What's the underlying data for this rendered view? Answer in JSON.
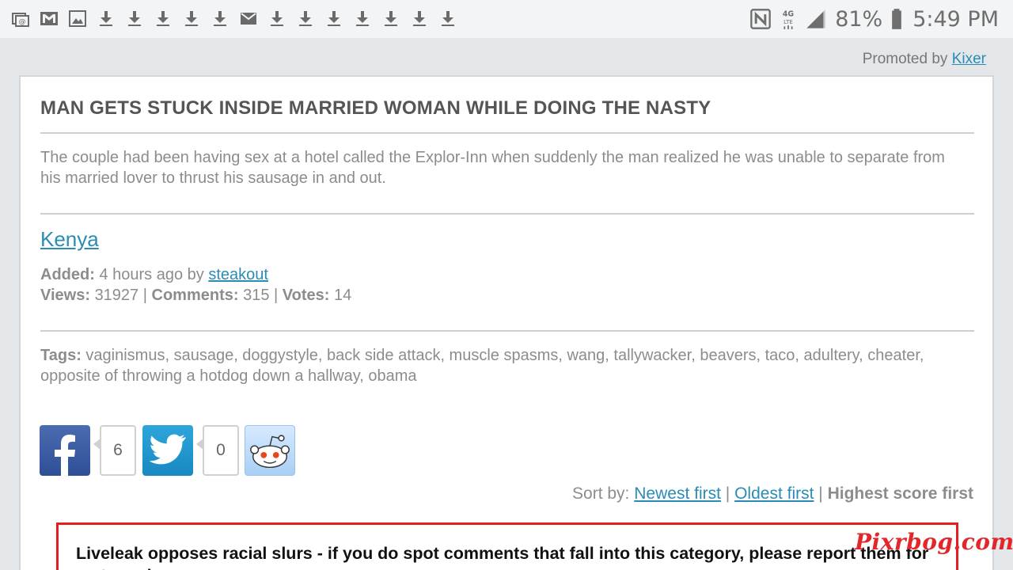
{
  "status_bar": {
    "left_icons": [
      "email-icon",
      "gmail-icon",
      "image-icon",
      "download-icon",
      "download-icon",
      "download-icon",
      "download-icon",
      "download-icon",
      "mail-icon",
      "download-icon",
      "download-icon",
      "download-icon",
      "download-icon",
      "download-icon",
      "download-icon",
      "download-icon",
      "download-icon"
    ],
    "battery": "81%",
    "time": "5:49 PM"
  },
  "promoted": {
    "prefix": "Promoted by",
    "link": "Kixer"
  },
  "article": {
    "title": "MAN GETS STUCK INSIDE MARRIED WOMAN WHILE DOING THE NASTY",
    "description": "The couple had been having sex at a hotel called the Explor-Inn when suddenly the man realized he was unable to separate from his married lover to thrust his sausage in and out.",
    "location": "Kenya",
    "added_label": "Added:",
    "added_value": "4 hours ago by",
    "author": "steakout",
    "views_label": "Views:",
    "views": "31927",
    "comments_label": "Comments:",
    "comments": "315",
    "votes_label": "Votes:",
    "votes": "14",
    "sep": "|",
    "tags_label": "Tags:",
    "tags": "vaginismus, sausage, doggystyle, back side attack, muscle spasms, wang, tallywacker, beavers, taco, adultery, cheater, opposite of throwing a hotdog down a hallway, obama"
  },
  "share": {
    "facebook_count": "6",
    "twitter_count": "0"
  },
  "sort": {
    "label": "Sort by:",
    "newest": "Newest first",
    "oldest": "Oldest first",
    "highest": "Highest score first",
    "sep": "|"
  },
  "notice": {
    "text": "Liveleak opposes racial slurs - if you do spot comments that fall into this category, please report them for us to review."
  },
  "watermark": "Pixrbog.com",
  "colors": {
    "link": "#2a8cb4",
    "notice_border": "#e41e1e",
    "watermark": "#e2262a"
  }
}
